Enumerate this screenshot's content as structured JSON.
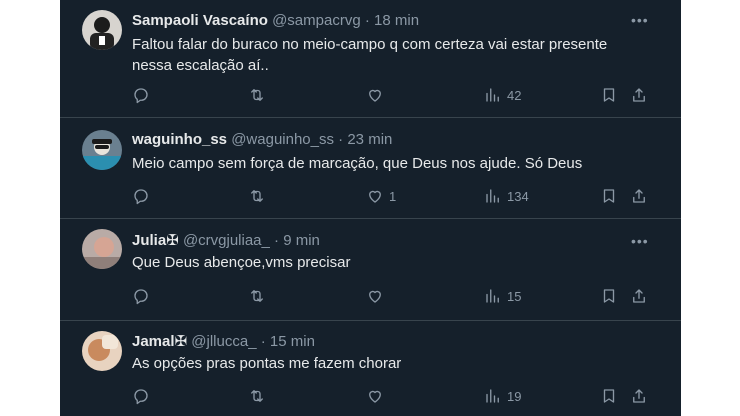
{
  "tweets": [
    {
      "name": "Sampaoli Vascaíno",
      "handle": "@sampacrvg",
      "time": "18 min",
      "text": "Faltou falar do buraco no meio-campo q com certeza vai estar presente nessa escalação aí..",
      "likes": "",
      "views": "42"
    },
    {
      "name": "waguinho_ss",
      "handle": "@waguinho_ss",
      "time": "23 min",
      "text": "Meio campo sem força de marcação,  que Deus nos ajude. Só Deus",
      "likes": "1",
      "views": "134"
    },
    {
      "name": "Julia✠",
      "handle": "@crvgjuliaa_",
      "time": "9 min",
      "text": "Que Deus abençoe,vms precisar",
      "likes": "",
      "views": "15"
    },
    {
      "name": "Jamal✠",
      "handle": "@jllucca_",
      "time": "15 min",
      "text": "As opções pras pontas me fazem chorar",
      "likes": "",
      "views": "19"
    }
  ],
  "separator": " · ",
  "more_glyph": "•••",
  "colors": {
    "background": "#15202b",
    "divider": "#38444d",
    "text_primary": "#e7e9ea",
    "text_secondary": "#8b98a5"
  },
  "icons": [
    "reply-icon",
    "retweet-icon",
    "like-icon",
    "views-icon",
    "bookmark-icon",
    "share-icon",
    "more-icon"
  ]
}
